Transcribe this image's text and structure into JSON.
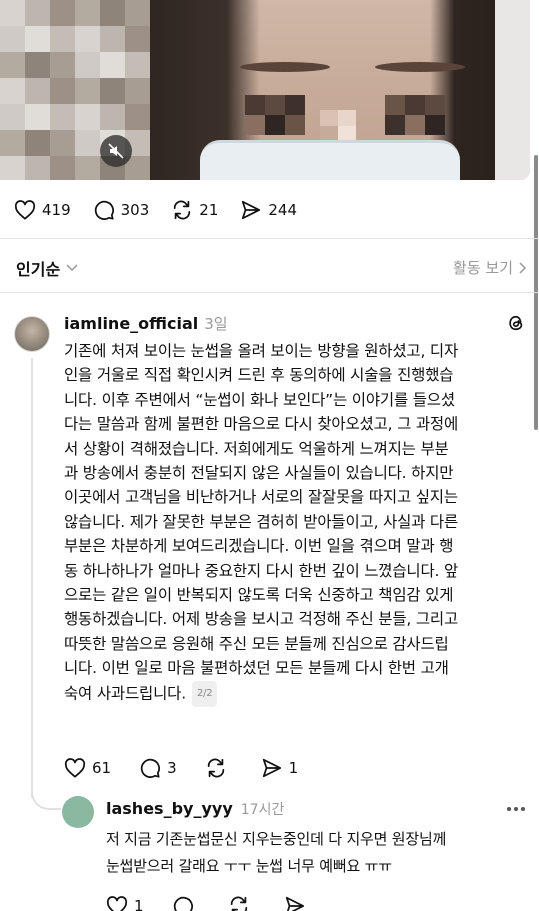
{
  "post_stats": {
    "likes": "419",
    "comments": "303",
    "reposts": "21",
    "shares": "244"
  },
  "sort": {
    "label": "인기순",
    "activity_label": "활동 보기"
  },
  "reply": {
    "username": "iamline_official",
    "time": "3일",
    "lines": [
      "기존에 처져 보이는 눈썹을 올려 보이는 방향을 원하셨고, 디자",
      "인을 거울로 직접 확인시켜 드린 후 동의하에 시술을 진행했습",
      "니다. 이후 주변에서 “눈썹이 화나 보인다”는 이야기를 들으셨",
      "다는 말씀과 함께 불편한 마음으로 다시 찾아오셨고, 그 과정에",
      "서 상황이 격해졌습니다. 저희에게도 억울하게 느껴지는 부분",
      "과 방송에서 충분히 전달되지 않은 사실들이 있습니다. 하지만",
      "이곳에서 고객님을 비난하거나 서로의 잘잘못을 따지고 싶지는",
      "않습니다. 제가 잘못한 부분은 겸허히 받아들이고, 사실과 다른",
      "부분은 차분하게 보여드리겠습니다. 이번 일을 겪으며 말과 행",
      "동 하나하나가 얼마나 중요한지 다시 한번 깊이 느꼈습니다. 앞",
      "으로는 같은 일이 반복되지 않도록 더욱 신중하고 책임감 있게",
      "행동하겠습니다. 어제 방송을 보시고 걱정해 주신 분들, 그리고",
      "따뜻한 말씀으로 응원해 주신 모든 분들께 진심으로 감사드립",
      "니다. 이번 일로 마음 불편하셨던 모든 분들께 다시 한번 고개"
    ],
    "last_line": "숙여 사과드립니다.",
    "page_indicator": "2/2",
    "likes": "61",
    "comments": "3",
    "shares": "1"
  },
  "nested_reply": {
    "username": "lashes_by_yyy",
    "time": "17시간",
    "lines": [
      "저 지금 기존눈썹문신 지우는중인데 다 지우면 원장님께",
      "눈썹받으러 갈래요 ㅜㅜ 눈썹 너무 예뻐요 ㅠㅠ"
    ],
    "likes": "1"
  }
}
